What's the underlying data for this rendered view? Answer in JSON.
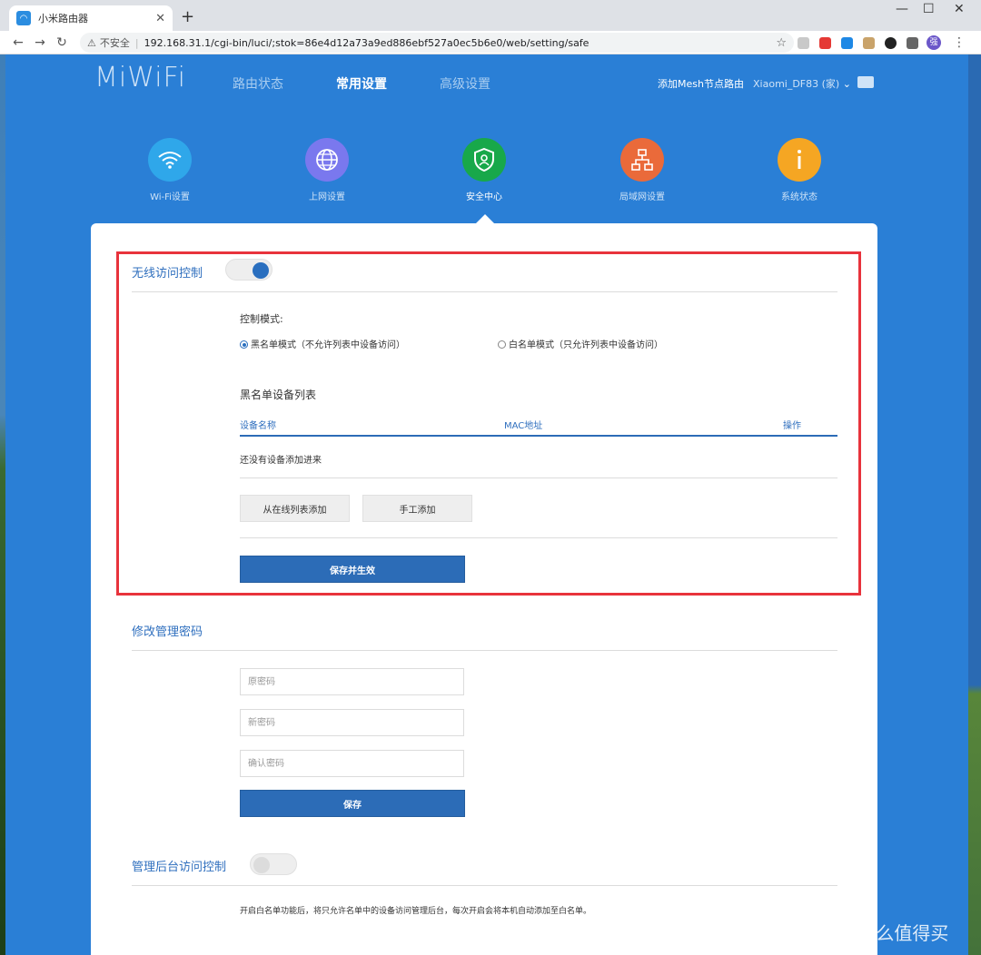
{
  "browser": {
    "tab_title": "小米路由器",
    "new_tab": "+",
    "insecure_label": "不安全",
    "url": "192.168.31.1/cgi-bin/luci/;stok=86e4d12a73a9ed886ebf527a0ec5b6e0/web/setting/safe",
    "profile_initial": "强"
  },
  "header": {
    "logo": "MiWiFi",
    "nav": [
      "路由状态",
      "常用设置",
      "高级设置"
    ],
    "active_nav": "常用设置",
    "mesh_link": "添加Mesh节点路由",
    "router_name": "Xiaomi_DF83 (家)"
  },
  "categories": [
    {
      "label": "Wi-Fi设置",
      "icon": "wifi-icon",
      "color": "#2fa7ea"
    },
    {
      "label": "上网设置",
      "icon": "globe-icon",
      "color": "#7a78ee"
    },
    {
      "label": "安全中心",
      "icon": "shield-icon",
      "color": "#18a84a"
    },
    {
      "label": "局域网设置",
      "icon": "network-icon",
      "color": "#ea6a3a"
    },
    {
      "label": "系统状态",
      "icon": "info-icon",
      "color": "#f5a623"
    }
  ],
  "wireless_access": {
    "title": "无线访问控制",
    "enabled": true,
    "mode_label": "控制模式:",
    "blacklist_option": "黑名单模式（不允许列表中设备访问）",
    "whitelist_option": "白名单模式（只允许列表中设备访问）",
    "selected_mode": "blacklist",
    "list_title": "黑名单设备列表",
    "columns": [
      "设备名称",
      "MAC地址",
      "操作"
    ],
    "empty_text": "还没有设备添加进来",
    "add_from_online": "从在线列表添加",
    "add_manual": "手工添加",
    "save_apply": "保存并生效"
  },
  "admin_password": {
    "title": "修改管理密码",
    "old_placeholder": "原密码",
    "new_placeholder": "新密码",
    "confirm_placeholder": "确认密码",
    "save": "保存"
  },
  "admin_access": {
    "title": "管理后台访问控制",
    "enabled": false,
    "note": "开启白名单功能后，将只允许名单中的设备访问管理后台，每次开启会将本机自动添加至白名单。"
  },
  "watermark": "值 什么值得买",
  "colors": {
    "page_bg": "#2a7fd6",
    "accent": "#2c6cb7",
    "highlight_border": "#e8333c"
  }
}
